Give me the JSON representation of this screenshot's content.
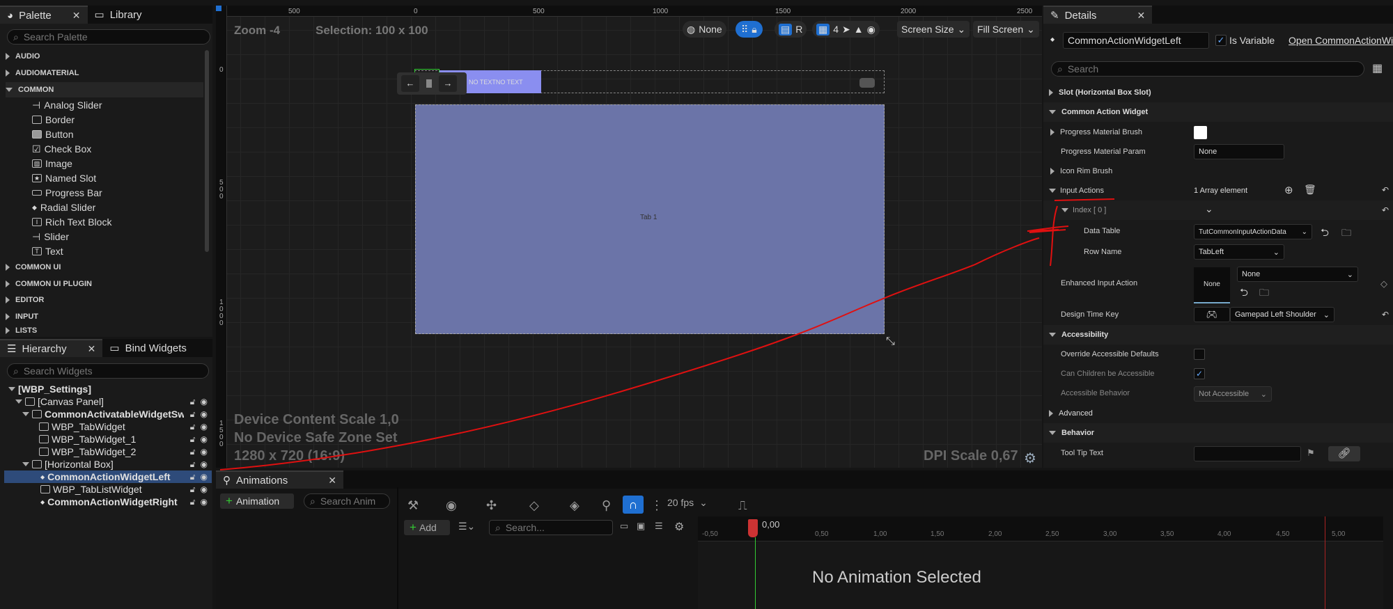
{
  "palette": {
    "tab_palette": "Palette",
    "tab_library": "Library",
    "search_placeholder": "Search Palette",
    "categories": [
      "AUDIO",
      "AUDIOMATERIAL",
      "COMMON",
      "COMMON UI",
      "COMMON UI PLUGIN",
      "EDITOR",
      "INPUT",
      "LISTS"
    ],
    "items": [
      "Analog Slider",
      "Border",
      "Button",
      "Check Box",
      "Image",
      "Named Slot",
      "Progress Bar",
      "Radial Slider",
      "Rich Text Block",
      "Slider",
      "Text"
    ]
  },
  "hierarchy": {
    "tab_hierarchy": "Hierarchy",
    "tab_bind": "Bind Widgets",
    "search_placeholder": "Search Widgets",
    "items": [
      "[WBP_Settings]",
      "[Canvas Panel]",
      "CommonActivatableWidgetSwit",
      "WBP_TabWidget",
      "WBP_TabWidget_1",
      "WBP_TabWidget_2",
      "[Horizontal Box]",
      "CommonActionWidgetLeft",
      "WBP_TabListWidget",
      "CommonActionWidgetRight"
    ]
  },
  "viewport": {
    "zoom": "Zoom -4",
    "selection": "Selection: 100 x 100",
    "none_btn": "None",
    "r_btn": "R",
    "grid_num": "4",
    "screen_size": "Screen Size",
    "fill_screen": "Fill Screen",
    "ruler_top": [
      "500",
      "0",
      "500",
      "1000",
      "1500",
      "2000",
      "2500"
    ],
    "ruler_left": [
      "0",
      "5\n0\n0",
      "1\n0\n0\n0",
      "1\n5\n0\n0"
    ],
    "widget_text": "NO TEXTNO TEXT",
    "tab_label": "Tab 1",
    "device_scale": "Device Content Scale 1,0",
    "safe_zone": "No Device Safe Zone Set",
    "resolution": "1280 x 720 (16:9)",
    "dpi": "DPI Scale 0,67",
    "arrow_left": "←",
    "arrow_right": "→"
  },
  "details": {
    "tab": "Details",
    "name_value": "CommonActionWidgetLeft",
    "is_variable": "Is Variable",
    "open_link": "Open CommonActionWi",
    "search_placeholder": "Search",
    "sections": {
      "slot": "Slot (Horizontal Box Slot)",
      "cаw": "Common Action Widget",
      "accessibility": "Accessibility",
      "advanced": "Advanced",
      "behavior": "Behavior"
    },
    "rows": {
      "progress_brush": "Progress Material Brush",
      "progress_param": "Progress Material Param",
      "progress_param_value": "None",
      "icon_rim": "Icon Rim Brush",
      "input_actions": "Input Actions",
      "array_count": "1 Array element",
      "index": "Index [ 0 ]",
      "data_table": "Data Table",
      "data_table_value": "TutCommonInputActionData",
      "row_name": "Row Name",
      "row_name_value": "TabLeft",
      "enhanced": "Enhanced Input Action",
      "enhanced_thumb": "None",
      "enhanced_value": "None",
      "design_key": "Design Time Key",
      "design_key_value": "Gamepad Left Shoulder",
      "override": "Override Accessible Defaults",
      "children": "Can Children be Accessible",
      "acc_behavior": "Accessible Behavior",
      "acc_behavior_value": "Not Accessible",
      "tooltip": "Tool Tip Text"
    }
  },
  "animations": {
    "tab": "Animations",
    "add_anim": "Animation",
    "search_anim": "Search Anim",
    "add": "Add",
    "search_placeholder": "Search...",
    "fps": "20 fps",
    "time_marker": "0,00",
    "ticks": [
      "-0,50",
      "0,50",
      "1,00",
      "1,50",
      "2,00",
      "2,50",
      "3,00",
      "3,50",
      "4,00",
      "4,50",
      "5,00"
    ],
    "empty": "No Animation Selected"
  },
  "colors": {
    "selection": "#2e4b7a",
    "widget_fill": "#6b74a8",
    "annotation": "#e01010"
  }
}
